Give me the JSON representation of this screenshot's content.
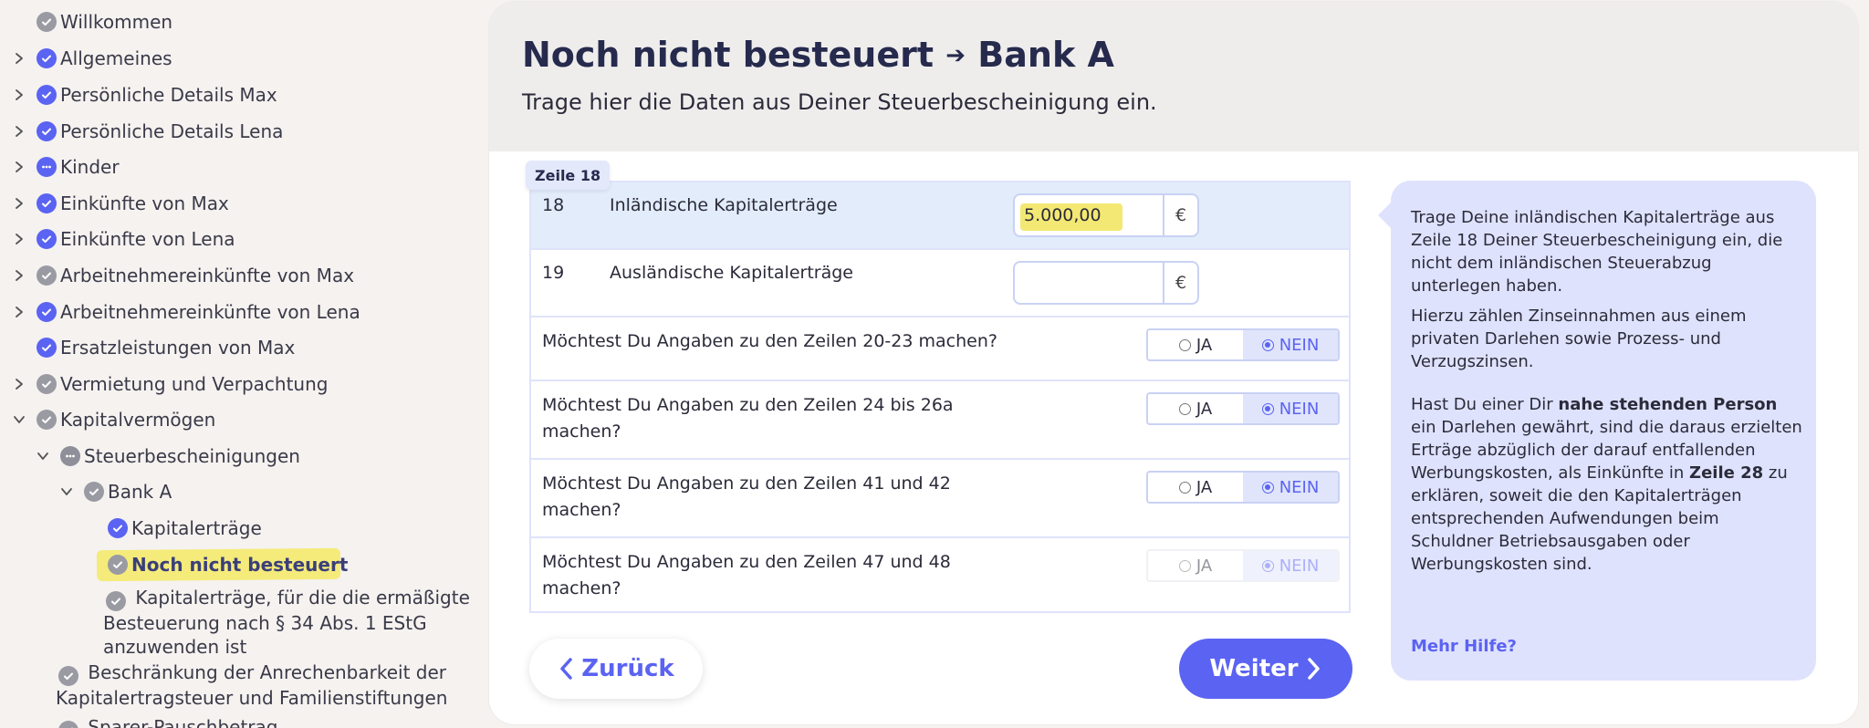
{
  "sidebar": {
    "items": [
      {
        "label": "Willkommen",
        "status": "gray",
        "expandable": false
      },
      {
        "label": "Allgemeines",
        "status": "done",
        "expandable": true
      },
      {
        "label": "Persönliche Details Max",
        "status": "done",
        "expandable": true
      },
      {
        "label": "Persönliche Details Lena",
        "status": "done",
        "expandable": true
      },
      {
        "label": "Kinder",
        "status": "partial",
        "expandable": true
      },
      {
        "label": "Einkünfte von Max",
        "status": "done",
        "expandable": true
      },
      {
        "label": "Einkünfte von Lena",
        "status": "done",
        "expandable": true
      },
      {
        "label": "Arbeitnehmereinkünfte von Max",
        "status": "gray",
        "expandable": true
      },
      {
        "label": "Arbeitnehmereinkünfte von Lena",
        "status": "done",
        "expandable": true
      },
      {
        "label": "Ersatzleistungen von Max",
        "status": "done",
        "expandable": false
      },
      {
        "label": "Vermietung und Verpachtung",
        "status": "gray",
        "expandable": true
      },
      {
        "label": "Kapitalvermögen",
        "status": "gray",
        "expanded": true
      },
      {
        "label": "Steuerbescheinigungen",
        "status": "partial-gray",
        "expanded": true
      },
      {
        "label": "Bank A",
        "status": "gray",
        "expanded": true
      },
      {
        "label": "Kapitalerträge",
        "status": "done"
      },
      {
        "label": "Noch nicht besteuert",
        "status": "current"
      }
    ],
    "multi": {
      "ermaessigt": [
        "Kapitalerträge, für die die ermäßigte",
        "Besteuerung nach § 34 Abs. 1 EStG",
        "anzuwenden ist"
      ],
      "beschraenkung": [
        "Beschränkung der Anrechenbarkeit der",
        "Kapitalertragsteuer und Familienstiftungen"
      ],
      "sparer": "Sparer-Pauschbetrag"
    }
  },
  "header": {
    "title": "Noch nicht besteuert",
    "arrow": "➔",
    "bank": "Bank A",
    "subtitle": "Trage hier die Daten aus Deiner Steuerbescheinigung ein."
  },
  "form": {
    "tag": "Zeile 18",
    "rows": [
      {
        "num": "18",
        "label": "Inländische Kapitalerträge",
        "value": "5.000,00",
        "unit": "€"
      },
      {
        "num": "19",
        "label": "Ausländische Kapitalerträge",
        "value": "",
        "unit": "€"
      }
    ],
    "questions": [
      {
        "label": "Möchtest Du Angaben zu den Zeilen 20-23 machen?",
        "selected": "NEIN"
      },
      {
        "label": "Möchtest Du Angaben zu den Zeilen 24 bis 26a machen?",
        "selected": "NEIN"
      },
      {
        "label": "Möchtest Du Angaben zu den Zeilen 41 und 42 machen?",
        "selected": "NEIN"
      },
      {
        "label": "Möchtest Du Angaben zu den Zeilen 47 und 48 machen?",
        "selected": "NEIN",
        "disabled": true
      }
    ],
    "yes_label": "JA",
    "no_label": "NEIN"
  },
  "buttons": {
    "back": "Zurück",
    "next": "Weiter"
  },
  "help": {
    "p1": "Trage Deine inländischen Kapitalerträge aus Zeile 18 Deiner Steuerbescheinigung ein, die nicht dem inländischen Steuerabzug unterlegen haben.",
    "p2": "Hierzu zählen Zinseinnahmen aus einem privaten Darlehen sowie Prozess- und Verzugszinsen.",
    "p3_a": "Hast Du einer Dir ",
    "p3_b": "nahe stehenden Person",
    "p3_c": " ein Darlehen gewährt, sind die daraus erzielten Erträge abzüglich der darauf entfallenden Werbungskosten, als Einkünfte in ",
    "p3_d": "Zeile 28",
    "p3_e": " zu erklären, soweit die den Kapitalerträgen entsprechenden Aufwendungen beim Schuldner Betriebsausgaben oder Werbungskosten sind.",
    "link": "Mehr Hilfe?"
  },
  "colors": {
    "accent": "#5b63f2",
    "highlight": "#f3e873",
    "help_bg": "#dfe2fd"
  }
}
